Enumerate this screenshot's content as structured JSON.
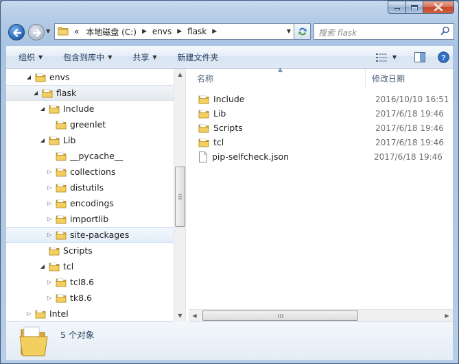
{
  "address": {
    "overflow": "«",
    "crumbs": [
      "本地磁盘 (C:)",
      "envs",
      "flask"
    ]
  },
  "search": {
    "placeholder": "搜索 flask"
  },
  "toolbar": {
    "organize": "组织",
    "include_in_library": "包含到库中",
    "share": "共享",
    "new_folder": "新建文件夹"
  },
  "tree": [
    {
      "label": "envs",
      "depth": 0,
      "expanded": true
    },
    {
      "label": "flask",
      "depth": 1,
      "expanded": true,
      "selected": true
    },
    {
      "label": "Include",
      "depth": 2,
      "expanded": true
    },
    {
      "label": "greenlet",
      "depth": 3,
      "expanded": null
    },
    {
      "label": "Lib",
      "depth": 2,
      "expanded": true
    },
    {
      "label": "__pycache__",
      "depth": 3,
      "expanded": null
    },
    {
      "label": "collections",
      "depth": 3,
      "expanded": false
    },
    {
      "label": "distutils",
      "depth": 3,
      "expanded": false
    },
    {
      "label": "encodings",
      "depth": 3,
      "expanded": false
    },
    {
      "label": "importlib",
      "depth": 3,
      "expanded": false
    },
    {
      "label": "site-packages",
      "depth": 3,
      "expanded": false,
      "hover": true
    },
    {
      "label": "Scripts",
      "depth": 2,
      "expanded": null
    },
    {
      "label": "tcl",
      "depth": 2,
      "expanded": true
    },
    {
      "label": "tcl8.6",
      "depth": 3,
      "expanded": false
    },
    {
      "label": "tk8.6",
      "depth": 3,
      "expanded": false
    },
    {
      "label": "Intel",
      "depth": 0,
      "expanded": false
    }
  ],
  "columns": {
    "name": "名称",
    "date": "修改日期"
  },
  "files": [
    {
      "name": "Include",
      "date": "2016/10/10 16:51",
      "type": "folder"
    },
    {
      "name": "Lib",
      "date": "2017/6/18 19:46",
      "type": "folder"
    },
    {
      "name": "Scripts",
      "date": "2017/6/18 19:46",
      "type": "folder"
    },
    {
      "name": "tcl",
      "date": "2017/6/18 19:46",
      "type": "folder"
    },
    {
      "name": "pip-selfcheck.json",
      "date": "2017/6/18 19:46",
      "type": "file"
    }
  ],
  "status": {
    "count": "5 个对象"
  },
  "colors": {
    "folder": "#e8c04a",
    "accent": "#1e3a5f"
  }
}
